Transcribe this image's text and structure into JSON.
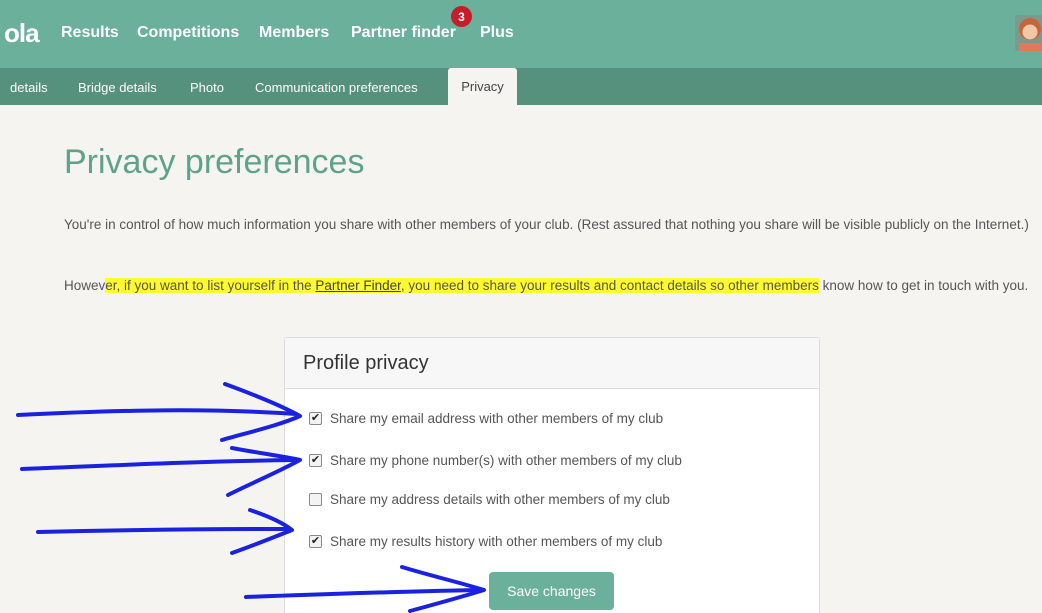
{
  "brand": {
    "logo_text": "ola"
  },
  "nav": {
    "items": [
      "Results",
      "Competitions",
      "Members",
      "Partner finder",
      "Plus"
    ],
    "partner_badge": "3"
  },
  "tabs": {
    "items": [
      "details",
      "Bridge details",
      "Photo",
      "Communication preferences"
    ],
    "active": "Privacy"
  },
  "page": {
    "title": "Privacy preferences",
    "intro": "You're in control of how much information you share with other members of your club. (Rest assured that nothing you share will be visible publicly on the Internet.)",
    "p2_before": "Howev",
    "p2_hl_a": "er, if you want to list yourself in the ",
    "p2_link": "Partner Finder",
    "p2_hl_b": ", you need to share your results and contact details so other members",
    "p2_after": " know how to get in touch with you."
  },
  "panel": {
    "title": "Profile privacy",
    "options": [
      {
        "label": "Share my email address with other members of my club",
        "checked": true
      },
      {
        "label": "Share my phone number(s) with other members of my club",
        "checked": true
      },
      {
        "label": "Share my address details with other members of my club",
        "checked": false
      },
      {
        "label": "Share my results history with other members of my club",
        "checked": true
      }
    ],
    "save_label": "Save changes"
  },
  "colors": {
    "header": "#6ab09a",
    "subheader": "#55917d",
    "title": "#5ea28b",
    "highlight": "#fffa2e",
    "annotation": "#1a22e0",
    "badge": "#c81c2b"
  }
}
